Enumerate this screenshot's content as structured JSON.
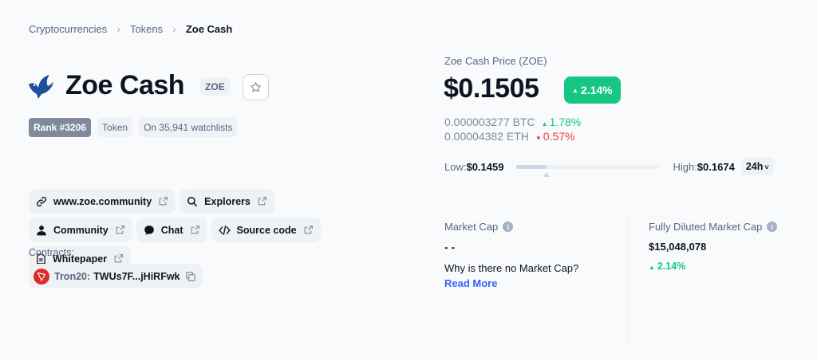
{
  "breadcrumb": [
    "Cryptocurrencies",
    "Tokens",
    "Zoe Cash"
  ],
  "coin": {
    "name": "Zoe Cash",
    "symbol": "ZOE",
    "logo_icon": "bird-logo-icon",
    "rank": "Rank #3206",
    "type": "Token",
    "watchlists": "On 35,941 watchlists"
  },
  "links": [
    {
      "label": "www.zoe.community",
      "icon": "link-icon"
    },
    {
      "label": "Explorers",
      "icon": "search-icon"
    },
    {
      "label": "Community",
      "icon": "user-icon"
    },
    {
      "label": "Chat",
      "icon": "chat-icon"
    },
    {
      "label": "Source code",
      "icon": "code-icon"
    },
    {
      "label": "Whitepaper",
      "icon": "document-icon"
    }
  ],
  "contracts": {
    "label": "Contracts:",
    "network": "Tron20:",
    "address": "TWUs7F...jHiRFwk"
  },
  "price": {
    "label": "Zoe Cash Price (ZOE)",
    "value": "$0.1505",
    "change": "2.14%",
    "btc": "0.000003277 BTC",
    "btc_change": "1.78%",
    "eth": "0.00004382 ETH",
    "eth_change": "0.57%"
  },
  "range": {
    "low_label": "Low:",
    "low": "$0.1459",
    "high_label": "High:",
    "high": "$0.1674",
    "position": 0.21,
    "timeframe": "24h"
  },
  "stats": {
    "market_cap_label": "Market Cap",
    "market_cap_value": "- -",
    "why": "Why is there no Market Cap?",
    "read_more": "Read More",
    "fdmc_label": "Fully Diluted Market Cap",
    "fdmc_value": "$15,048,078",
    "fdmc_change": "2.14%"
  },
  "colors": {
    "green": "#16c784",
    "red": "#ea3943",
    "blue": "#3861fb"
  }
}
